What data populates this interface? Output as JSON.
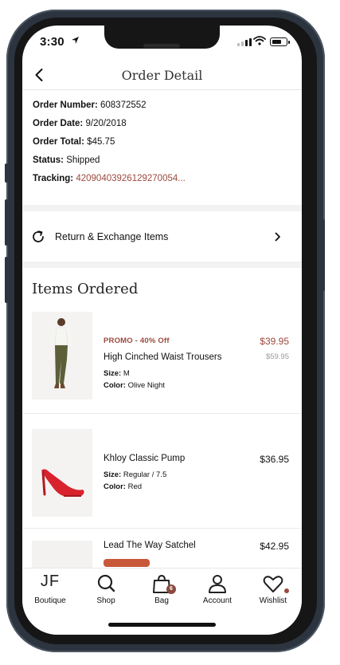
{
  "status_bar": {
    "time": "3:30"
  },
  "nav": {
    "title": "Order Detail"
  },
  "order": {
    "number_label": "Order Number:",
    "number": "608372552",
    "date_label": "Order Date:",
    "date": "9/20/2018",
    "total_label": "Order Total:",
    "total": "$45.75",
    "status_label": "Status:",
    "status": "Shipped",
    "tracking_label": "Tracking:",
    "tracking": "42090403926129270054..."
  },
  "return_row": {
    "label": "Return & Exchange Items"
  },
  "items_section": {
    "title": "Items Ordered"
  },
  "items": [
    {
      "promo": "PROMO - 40% Off",
      "name": "High Cinched Waist Trousers",
      "price": "$39.95",
      "original_price": "$59.95",
      "size_label": "Size:",
      "size": "M",
      "color_label": "Color:",
      "color": "Olive Night"
    },
    {
      "name": "Khloy Classic Pump",
      "price": "$36.95",
      "size_label": "Size:",
      "size": "Regular / 7.5",
      "color_label": "Color:",
      "color": "Red"
    },
    {
      "name": "Lead The Way Satchel",
      "price": "$42.95"
    }
  ],
  "tabbar": {
    "boutique_logo": "JF",
    "boutique": "Boutique",
    "shop": "Shop",
    "bag": "Bag",
    "bag_count": "6",
    "account": "Account",
    "wishlist": "Wishlist"
  },
  "colors": {
    "accent": "#9c4a3e",
    "frame": "#2c3440"
  }
}
